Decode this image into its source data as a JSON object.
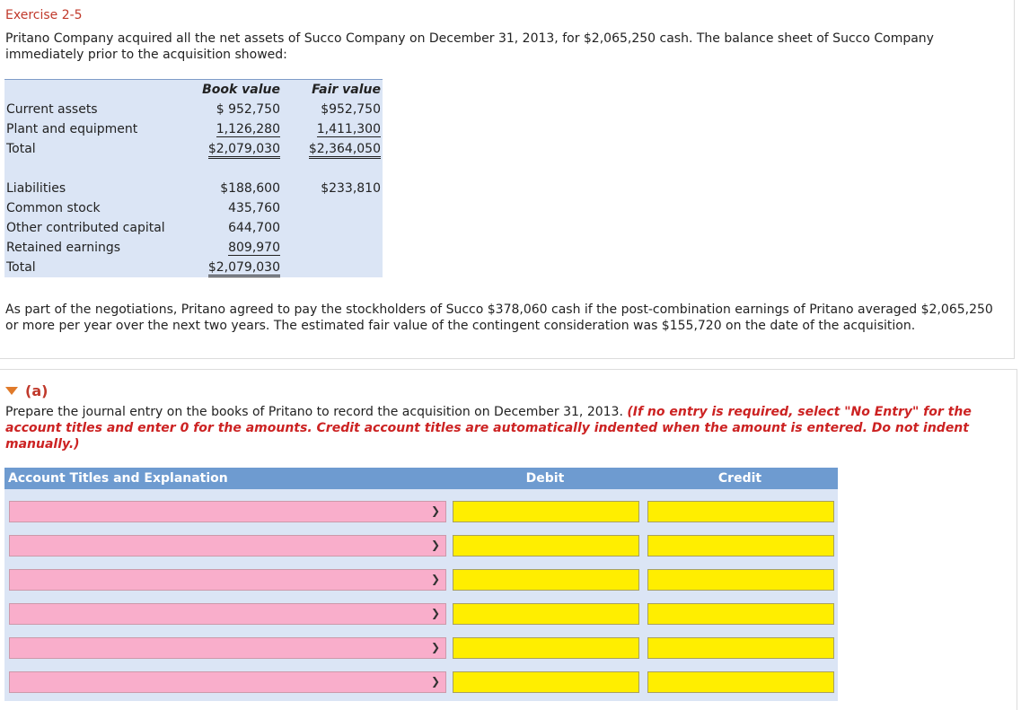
{
  "exercise": {
    "title": "Exercise 2-5",
    "intro": "Pritano Company acquired all the net assets of Succo Company on December 31, 2013, for $2,065,250 cash. The balance sheet of Succo Company immediately prior to the acquisition showed:"
  },
  "balance_sheet": {
    "headers": {
      "book": "Book value",
      "fair": "Fair value"
    },
    "assets": [
      {
        "label": "Current assets",
        "book": "$ 952,750",
        "fair": "$952,750"
      },
      {
        "label": "Plant and equipment",
        "book": "1,126,280",
        "fair": "1,411,300"
      },
      {
        "label": "Total",
        "book": "$2,079,030",
        "fair": "$2,364,050"
      }
    ],
    "equities": [
      {
        "label": "Liabilities",
        "book": "$188,600",
        "fair": "$233,810"
      },
      {
        "label": "Common stock",
        "book": "435,760",
        "fair": ""
      },
      {
        "label": "Other contributed capital",
        "book": "644,700",
        "fair": ""
      },
      {
        "label": "Retained earnings",
        "book": "809,970",
        "fair": ""
      },
      {
        "label": "Total",
        "book": "$2,079,030",
        "fair": ""
      }
    ]
  },
  "negotiation_text": "As part of the negotiations, Pritano agreed to pay the stockholders of Succo $378,060 cash if the post-combination earnings of Pritano averaged $2,065,250 or more per year over the next two years. The estimated fair value of the contingent consideration was $155,720 on the date of the acquisition.",
  "part_a": {
    "label": "(a)",
    "instruction": "Prepare the journal entry on the books of Pritano to record the acquisition on December 31, 2013.",
    "note": "(If no entry is required, select \"No Entry\" for the account titles and enter 0 for the amounts. Credit account titles are automatically indented when the amount is entered. Do not indent manually.)"
  },
  "journal": {
    "headers": {
      "account": "Account Titles and Explanation",
      "debit": "Debit",
      "credit": "Credit"
    },
    "rows": [
      {
        "account": "",
        "debit": "",
        "credit": ""
      },
      {
        "account": "",
        "debit": "",
        "credit": ""
      },
      {
        "account": "",
        "debit": "",
        "credit": ""
      },
      {
        "account": "",
        "debit": "",
        "credit": ""
      },
      {
        "account": "",
        "debit": "",
        "credit": ""
      },
      {
        "account": "",
        "debit": "",
        "credit": ""
      }
    ]
  },
  "icons": {
    "dropdown": "chevron-down-icon",
    "collapse": "triangle-down-icon"
  },
  "colors": {
    "title_red": "#c0392b",
    "header_blue": "#6e9bd0",
    "row_shade": "#dbe5f5",
    "select_pink": "#f9aecb",
    "input_yellow": "#ffee00",
    "triangle_orange": "#e07a2a"
  }
}
